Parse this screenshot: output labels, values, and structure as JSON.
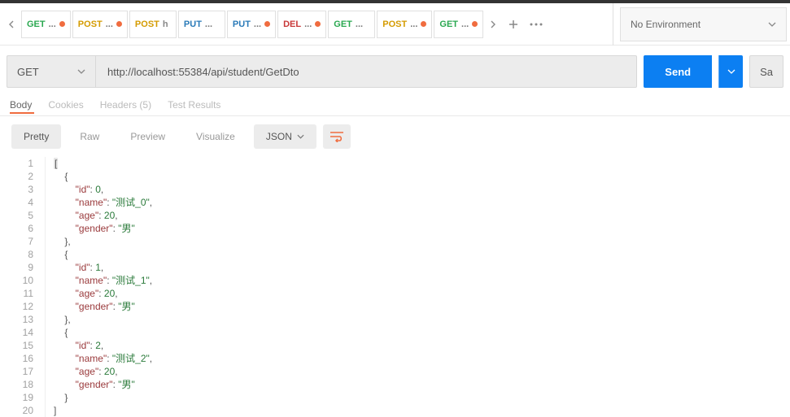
{
  "tabs": [
    {
      "method": "GET",
      "cls": "m-get",
      "suffix": "...",
      "dot": true
    },
    {
      "method": "POST",
      "cls": "m-post",
      "suffix": "...",
      "dot": true
    },
    {
      "method": "POST",
      "cls": "m-post",
      "suffix": "h",
      "dot": false
    },
    {
      "method": "PUT",
      "cls": "m-put",
      "suffix": "...",
      "dot": false
    },
    {
      "method": "PUT",
      "cls": "m-put",
      "suffix": "...",
      "dot": true
    },
    {
      "method": "DEL",
      "cls": "m-del",
      "suffix": "...",
      "dot": true
    },
    {
      "method": "GET",
      "cls": "m-get",
      "suffix": "...",
      "dot": false
    },
    {
      "method": "POST",
      "cls": "m-post",
      "suffix": "...",
      "dot": true
    },
    {
      "method": "GET",
      "cls": "m-get",
      "suffix": "...",
      "dot": true
    }
  ],
  "env": {
    "label": "No Environment"
  },
  "request": {
    "method": "GET",
    "url": "http://localhost:55384/api/student/GetDto",
    "send": "Send",
    "save": "Sa"
  },
  "sub_tabs": {
    "body": "Body",
    "cookies": "Cookies",
    "headers": "Headers (5)",
    "test": "Test Results"
  },
  "view_bar": {
    "pretty": "Pretty",
    "raw": "Raw",
    "preview": "Preview",
    "visualize": "Visualize",
    "format": "JSON"
  },
  "response_body": [
    {
      "id": 0,
      "name": "测试_0",
      "age": 20,
      "gender": "男"
    },
    {
      "id": 1,
      "name": "测试_1",
      "age": 20,
      "gender": "男"
    },
    {
      "id": 2,
      "name": "测试_2",
      "age": 20,
      "gender": "男"
    }
  ]
}
